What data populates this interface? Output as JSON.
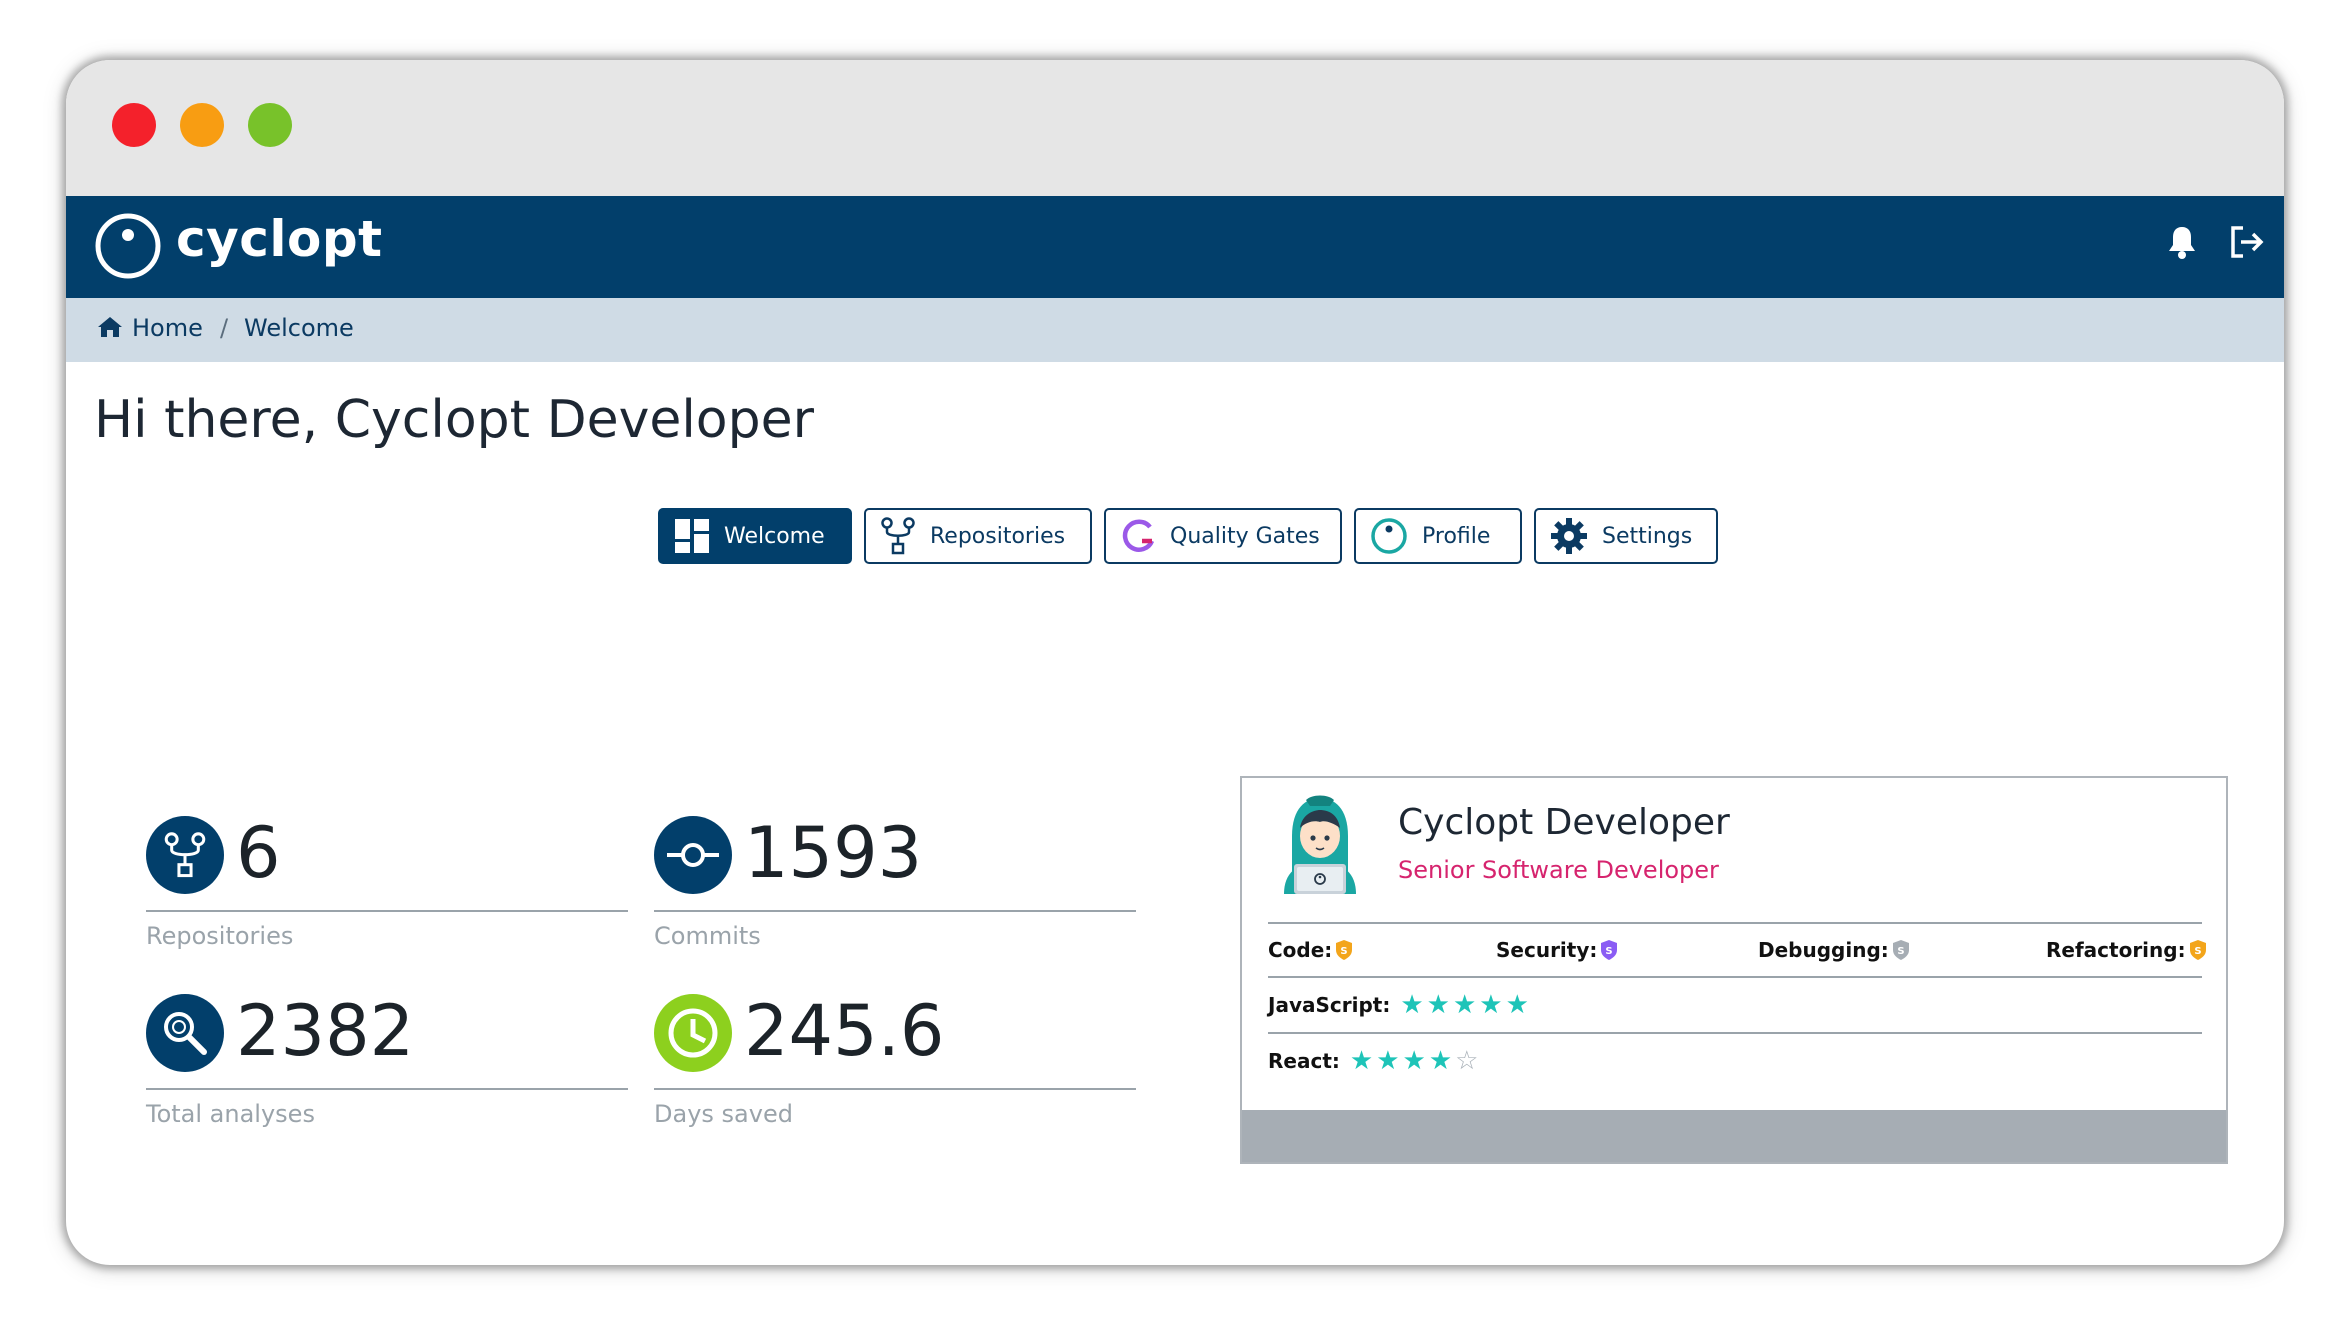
{
  "window": {
    "controls": [
      "close",
      "minimize",
      "maximize"
    ]
  },
  "app": {
    "name": "cyclopt",
    "brand_color": "#023f6b",
    "accent_color": "#d6246e"
  },
  "header": {
    "icons": [
      "bell-icon",
      "logout-icon"
    ]
  },
  "breadcrumb": {
    "items": [
      "Home",
      "Welcome"
    ],
    "separator": "/"
  },
  "greeting": "Hi there, Cyclopt Developer",
  "tabs": [
    {
      "label": "Welcome",
      "icon": "dashboard-icon",
      "active": true
    },
    {
      "label": "Repositories",
      "icon": "repository-icon",
      "active": false
    },
    {
      "label": "Quality Gates",
      "icon": "quality-gate-icon",
      "active": false
    },
    {
      "label": "Profile",
      "icon": "profile-icon",
      "active": false
    },
    {
      "label": "Settings",
      "icon": "gear-icon",
      "active": false
    }
  ],
  "stats": [
    {
      "value": "6",
      "label": "Repositories",
      "icon": "repository-icon",
      "color": "#023f6b"
    },
    {
      "value": "1593",
      "label": "Commits",
      "icon": "commit-icon",
      "color": "#023f6b"
    },
    {
      "value": "2382",
      "label": "Total analyses",
      "icon": "analysis-icon",
      "color": "#023f6b"
    },
    {
      "value": "245.6",
      "label": "Days saved",
      "icon": "clock-icon",
      "color": "#8dd01e"
    }
  ],
  "profile_card": {
    "name": "Cyclopt Developer",
    "role": "Senior Software Developer",
    "skills": [
      {
        "label": "Code:",
        "badge_color": "#f3a51b"
      },
      {
        "label": "Security:",
        "badge_color": "#8a5cf4"
      },
      {
        "label": "Debugging:",
        "badge_color": "#a6adb4"
      },
      {
        "label": "Refactoring:",
        "badge_color": "#f3a51b"
      }
    ],
    "languages": [
      {
        "label": "JavaScript:",
        "stars": 5,
        "max": 5
      },
      {
        "label": "React:",
        "stars": 4,
        "max": 5
      }
    ]
  }
}
